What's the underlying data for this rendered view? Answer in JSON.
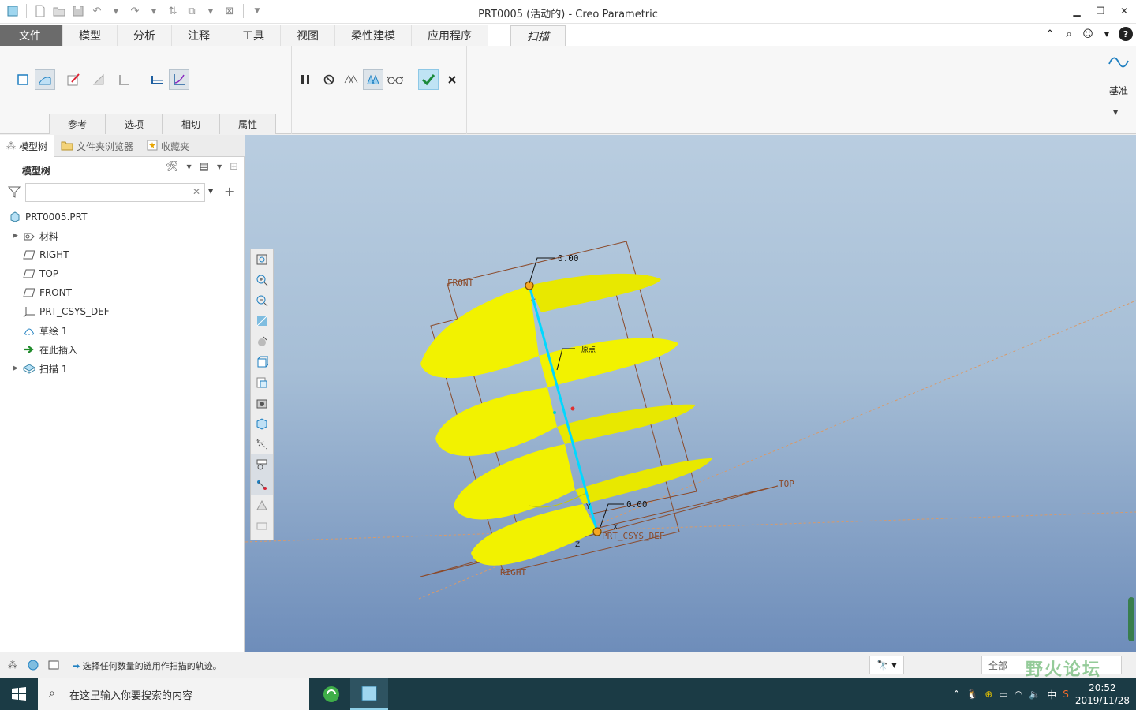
{
  "window": {
    "title": "PRT0005 (活动的) - Creo Parametric"
  },
  "menu": {
    "tabs": [
      {
        "label": "文件"
      },
      {
        "label": "模型"
      },
      {
        "label": "分析"
      },
      {
        "label": "注释"
      },
      {
        "label": "工具"
      },
      {
        "label": "视图"
      },
      {
        "label": "柔性建模"
      },
      {
        "label": "应用程序"
      }
    ],
    "active_tab": "扫描"
  },
  "ribbon": {
    "tabs": [
      "参考",
      "选项",
      "相切",
      "属性"
    ],
    "datum_label": "基准"
  },
  "panel": {
    "tabs": [
      "模型树",
      "文件夹浏览器",
      "收藏夹"
    ],
    "tree_title": "模型树",
    "filter_value": "",
    "items": [
      {
        "label": "PRT0005.PRT",
        "icon": "part-icon"
      },
      {
        "label": "材料",
        "icon": "material-icon"
      },
      {
        "label": "RIGHT",
        "icon": "datum-plane-icon"
      },
      {
        "label": "TOP",
        "icon": "datum-plane-icon"
      },
      {
        "label": "FRONT",
        "icon": "datum-plane-icon"
      },
      {
        "label": "PRT_CSYS_DEF",
        "icon": "csys-icon"
      },
      {
        "label": "草绘 1",
        "icon": "sketch-icon"
      },
      {
        "label": "在此插入",
        "icon": "insert-arrow-icon"
      },
      {
        "label": "扫描 1",
        "icon": "sweep-feature-icon"
      }
    ]
  },
  "viewport": {
    "labels": {
      "front": "FRONT",
      "top": "TOP",
      "right": "RIGHT",
      "csys": "PRT_CSYS_DEF",
      "dim_top": "0.00",
      "dim_bottom": "0.00",
      "mid": "原点",
      "x": "X",
      "y": "Y",
      "z": "Z"
    },
    "colors": {
      "surface": "#f2f200",
      "trajectory": "#00d8ff",
      "datum": "#8b4a2a"
    }
  },
  "status": {
    "message": "选择任何数量的链用作扫描的轨迹。",
    "filter": "全部",
    "watermark": "野火论坛"
  },
  "taskbar": {
    "search_placeholder": "在这里输入你要搜索的内容",
    "ime": "中",
    "time": "20:52",
    "date": "2019/11/28"
  }
}
